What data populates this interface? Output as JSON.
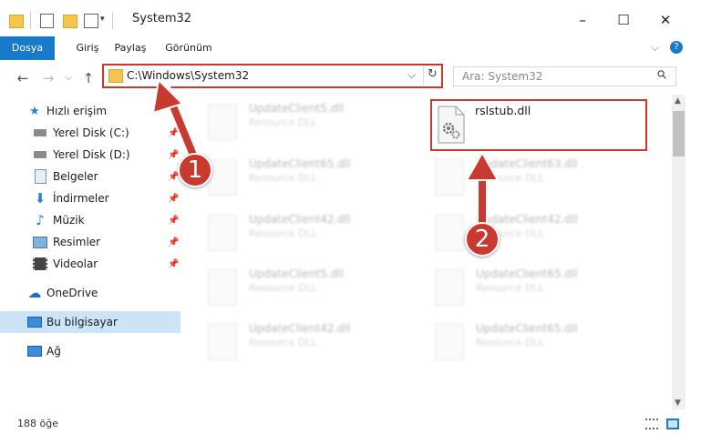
{
  "window": {
    "title": "System32",
    "minimize": "–",
    "maximize": "☐",
    "close": "✕"
  },
  "ribbon": {
    "tabs": [
      {
        "label": "Dosya",
        "active": true
      },
      {
        "label": "Giriş"
      },
      {
        "label": "Paylaş"
      },
      {
        "label": "Görünüm"
      }
    ],
    "expand_glyph": "⌵",
    "help_glyph": "?"
  },
  "address": {
    "path": "C:\\Windows\\System32",
    "dropdown_glyph": "⌵",
    "refresh_glyph": "↻",
    "search_placeholder": "Ara: System32",
    "search_glyph": "⚲"
  },
  "nav": {
    "back": "←",
    "forward": "→",
    "recent": "⌵",
    "up": "↑"
  },
  "sidebar": {
    "quick_access": "Hızlı erişim",
    "items": [
      {
        "label": "Yerel Disk (C:)",
        "icon": "drive-icon"
      },
      {
        "label": "Yerel Disk (D:)",
        "icon": "drive-icon"
      },
      {
        "label": "Belgeler",
        "icon": "documents-icon"
      },
      {
        "label": "İndirmeler",
        "icon": "downloads-icon"
      },
      {
        "label": "Müzik",
        "icon": "music-icon"
      },
      {
        "label": "Resimler",
        "icon": "pictures-icon"
      },
      {
        "label": "Videolar",
        "icon": "videos-icon"
      }
    ],
    "onedrive": "OneDrive",
    "this_pc": "Bu bilgisayar",
    "network": "Ağ"
  },
  "files": {
    "left": [
      {
        "name": "UpdateClient5.dll",
        "type": "Resource DLL"
      },
      {
        "name": "UpdateClient65.dll",
        "type": "Resource DLL"
      },
      {
        "name": "UpdateClient42.dll",
        "type": "Resource DLL"
      },
      {
        "name": "UpdateClient5.dll",
        "type": "Resource DLL"
      },
      {
        "name": "UpdateClient42.dll",
        "type": "Resource DLL"
      }
    ],
    "right": [
      {
        "name": "UpdateClient63.dll",
        "type": "Resource DLL"
      },
      {
        "name": "UpdateClient42.dll",
        "type": "Resource DLL"
      },
      {
        "name": "UpdateClient65.dll",
        "type": "Resource DLL"
      },
      {
        "name": "UpdateClient65.dll",
        "type": "Resource DLL"
      }
    ],
    "highlighted": {
      "name": "rslstub.dll"
    }
  },
  "annotations": {
    "one": "1",
    "two": "2",
    "color": "#c8392f"
  },
  "status": {
    "count": "188 öğe"
  },
  "colors": {
    "accent": "#1979ca",
    "annotation": "#c8392f"
  }
}
